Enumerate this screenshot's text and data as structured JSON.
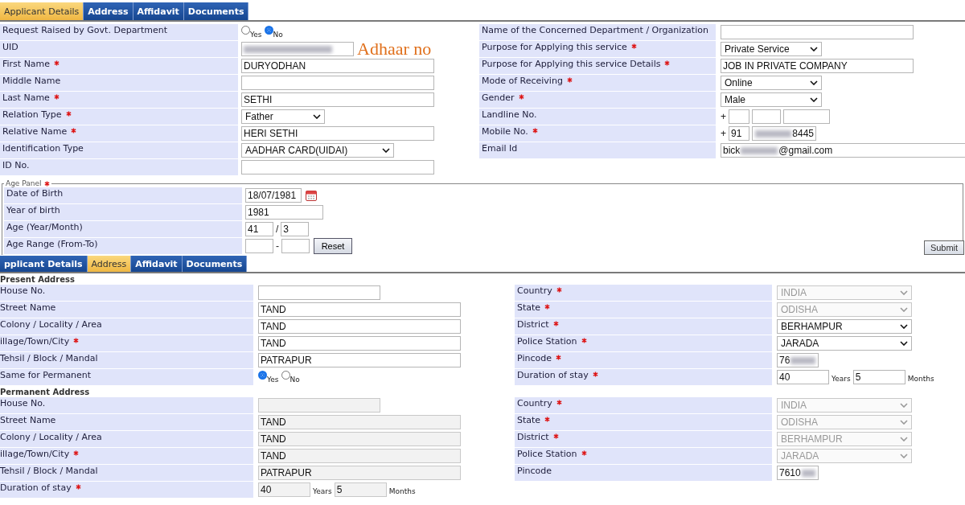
{
  "tabs": [
    {
      "label": "Applicant Details",
      "selected": true
    },
    {
      "label": "Address",
      "selected": false
    },
    {
      "label": "Affidavit",
      "selected": false
    },
    {
      "label": "Documents",
      "selected": false
    }
  ],
  "applicant_left": [
    {
      "label": "Request Raised by Govt. Department",
      "required": false,
      "kind": "radio",
      "options": [
        {
          "label": "Yes",
          "selected": false
        },
        {
          "label": "No",
          "selected": true
        }
      ]
    },
    {
      "label": "UID",
      "required": false,
      "kind": "short-text",
      "redacted": true,
      "note": "Adhaar no"
    },
    {
      "label": "First Name",
      "required": true,
      "kind": "text",
      "value": "DURYODHAN"
    },
    {
      "label": "Middle Name",
      "required": false,
      "kind": "text"
    },
    {
      "label": "Last Name",
      "required": true,
      "kind": "text",
      "value": "SETHI"
    },
    {
      "label": "Relation Type",
      "required": true,
      "kind": "select",
      "value": "Father"
    },
    {
      "label": "Relative Name",
      "required": true,
      "kind": "text",
      "value": "HERI SETHI"
    },
    {
      "label": "Identification Type",
      "required": false,
      "kind": "long-select",
      "value": "AADHAR CARD(UIDAI)"
    },
    {
      "label": "ID No.",
      "required": false,
      "kind": "text"
    }
  ],
  "applicant_right": [
    {
      "label": "Name of the Concerned Department / Organization",
      "required": false,
      "kind": "text"
    },
    {
      "label": "Purpose for Applying this service",
      "required": true,
      "kind": "select",
      "value": "Private Service"
    },
    {
      "label": "Purpose for Applying this service Details",
      "required": true,
      "kind": "text",
      "value": "JOB IN PRIVATE COMPANY"
    },
    {
      "label": "Mode of Receiving",
      "required": true,
      "kind": "select",
      "value": "Online"
    },
    {
      "label": "Gender",
      "required": true,
      "kind": "select",
      "value": "Male"
    },
    {
      "label": "Landline No.",
      "required": false,
      "kind": "landline",
      "prefix": "+"
    },
    {
      "label": "Mobile No.",
      "required": true,
      "kind": "mobile",
      "prefix": "+",
      "code": "91",
      "redacted": true,
      "value_end": "8445"
    },
    {
      "label": "Email Id",
      "required": false,
      "kind": "wide-text",
      "value_start": "bick",
      "redacted": true,
      "value_end": "@gmail.com"
    }
  ],
  "age_panel": {
    "legend": "Age Panel",
    "required": true,
    "rows": [
      {
        "label": "Date of Birth",
        "required": false,
        "kind": "date",
        "value": "18/07/1981"
      },
      {
        "label": "Year of birth",
        "required": false,
        "kind": "text",
        "value": "1981"
      },
      {
        "label": "Age (Year/Month)",
        "required": false,
        "kind": "pair",
        "values": [
          "41",
          "3"
        ],
        "separator": "/"
      },
      {
        "label": "Age Range (From-To)",
        "required": false,
        "kind": "pair",
        "separator": "-",
        "button": "Reset"
      }
    ]
  },
  "submit": "Submit",
  "address_tabs": [
    {
      "label": "pplicant Details",
      "selected": false
    },
    {
      "label": "Address",
      "selected": true
    },
    {
      "label": "Affidavit",
      "selected": false
    },
    {
      "label": "Documents",
      "selected": false
    }
  ],
  "present_address": {
    "heading": "Present Address",
    "left": [
      {
        "label": "House No.",
        "required": false,
        "kind": "short-text",
        "disabled": false
      },
      {
        "label": "Street Name",
        "required": false,
        "kind": "text",
        "value": "TAND",
        "disabled": false
      },
      {
        "label": "Colony / Locality / Area",
        "required": false,
        "kind": "text",
        "value": "TAND",
        "disabled": false
      },
      {
        "label": "illage/Town/City",
        "required": true,
        "kind": "text",
        "value": "TAND",
        "disabled": false
      },
      {
        "label": "Tehsil / Block / Mandal",
        "required": false,
        "kind": "text",
        "value": "PATRAPUR",
        "disabled": false
      },
      {
        "label": "Same for Permanent",
        "required": false,
        "kind": "radio",
        "options": [
          {
            "label": "Yes",
            "selected": true
          },
          {
            "label": "No",
            "selected": false
          }
        ]
      }
    ],
    "right": [
      {
        "label": "Country",
        "required": true,
        "kind": "long-select",
        "value": "INDIA",
        "disabled": true
      },
      {
        "label": "State",
        "required": true,
        "kind": "long-select",
        "value": "ODISHA",
        "disabled": true
      },
      {
        "label": "District",
        "required": true,
        "kind": "long-select",
        "value": "BERHAMPUR",
        "disabled": false
      },
      {
        "label": "Police Station",
        "required": true,
        "kind": "long-select",
        "value": "JARADA",
        "disabled": false
      },
      {
        "label": "Pincode",
        "required": true,
        "kind": "short-text",
        "value_start": "76",
        "redacted": true,
        "disabled": false
      },
      {
        "label": "Duration of stay",
        "required": true,
        "kind": "duration",
        "years": "40",
        "years_label": "Years",
        "months": "5",
        "months_label": "Months",
        "disabled": false
      }
    ]
  },
  "permanent_address": {
    "heading": "Permanent Address",
    "left": [
      {
        "label": "House No.",
        "required": false,
        "kind": "short-text",
        "disabled": true
      },
      {
        "label": "Street Name",
        "required": false,
        "kind": "text",
        "value": "TAND",
        "disabled": true
      },
      {
        "label": "Colony / Locality / Area",
        "required": false,
        "kind": "text",
        "value": "TAND",
        "disabled": true
      },
      {
        "label": "illage/Town/City",
        "required": true,
        "kind": "text",
        "value": "TAND",
        "disabled": true
      },
      {
        "label": "Tehsil / Block / Mandal",
        "required": false,
        "kind": "text",
        "value": "PATRAPUR",
        "disabled": true
      },
      {
        "label": "Duration of stay",
        "required": true,
        "kind": "duration",
        "years": "40",
        "years_label": "Years",
        "months": "5",
        "months_label": "Months",
        "disabled": true
      }
    ],
    "right": [
      {
        "label": "Country",
        "required": true,
        "kind": "long-select",
        "value": "INDIA",
        "disabled": true
      },
      {
        "label": "State",
        "required": true,
        "kind": "long-select",
        "value": "ODISHA",
        "disabled": true
      },
      {
        "label": "District",
        "required": true,
        "kind": "long-select",
        "value": "BERHAMPUR",
        "disabled": true
      },
      {
        "label": "Police Station",
        "required": true,
        "kind": "long-select",
        "value": "JARADA",
        "disabled": true
      },
      {
        "label": "Pincode",
        "required": false,
        "kind": "short-text",
        "value_start": "7610",
        "redacted": true,
        "disabled": false
      }
    ]
  }
}
